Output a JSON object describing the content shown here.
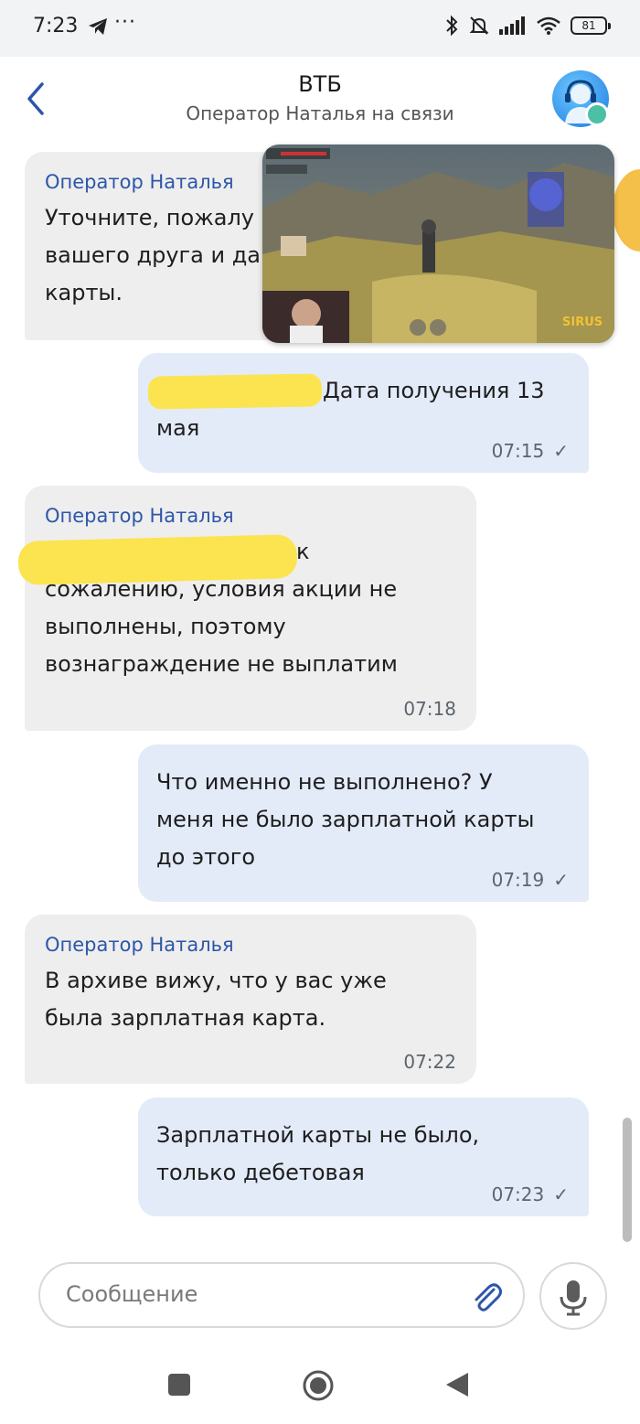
{
  "status_bar": {
    "time": "7:23",
    "more": "···",
    "battery": "81"
  },
  "header": {
    "title": "ВТБ",
    "subtitle": "Оператор Наталья на связи"
  },
  "messages": [
    {
      "direction": "in",
      "sender": "Оператор Наталья",
      "lines": [
        "Уточните, пожалу",
        "вашего друга и да",
        "карты."
      ]
    },
    {
      "direction": "out",
      "text_line1": "Дата получения 13",
      "text_line2": "мая",
      "time": "07:15",
      "status": "sent"
    },
    {
      "direction": "in",
      "sender": "Оператор Наталья",
      "line1_tail": "к",
      "line2": "сожалению, условия акции не",
      "line3": "выполнены, поэтому",
      "line4": "вознаграждение не выплатим",
      "time": "07:18"
    },
    {
      "direction": "out",
      "line1": "Что именно не выполнено? У",
      "line2": "меня не было зарплатной карты",
      "line3": "до этого",
      "time": "07:19",
      "status": "sent"
    },
    {
      "direction": "in",
      "sender": "Оператор Наталья",
      "line1": "В архиве вижу, что у вас уже",
      "line2": "была зарплатная карта.",
      "time": "07:22"
    },
    {
      "direction": "out",
      "line1": "Зарплатной карты не было,",
      "line2": "только дебетовая",
      "time": "07:23",
      "status": "sent"
    }
  ],
  "pip_video": {
    "watermark": "SIRUS"
  },
  "composer": {
    "placeholder": "Сообщение"
  },
  "colors": {
    "accent": "#2d56a9",
    "incoming_bubble": "#eeeeee",
    "outgoing_bubble": "#e3ebf9",
    "redaction": "#fbe44f"
  },
  "icons": {
    "back": "chevron-left-icon",
    "attach": "paperclip-icon",
    "mic": "microphone-icon",
    "check": "check-icon"
  }
}
